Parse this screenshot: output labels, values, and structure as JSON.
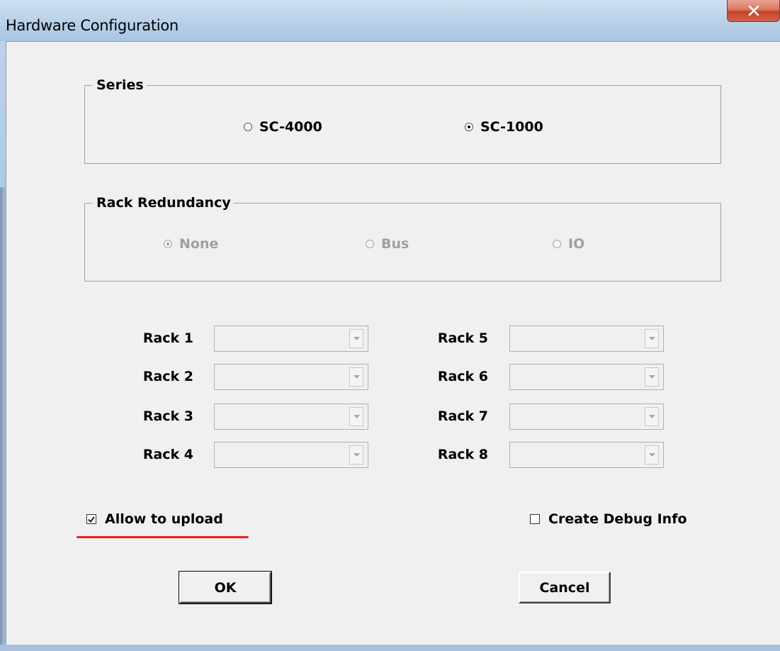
{
  "window": {
    "title": "Hardware Configuration",
    "close_glyph": "x"
  },
  "series": {
    "legend": "Series",
    "options": [
      {
        "label": "SC-4000",
        "checked": false
      },
      {
        "label": "SC-1000",
        "checked": true
      }
    ]
  },
  "rack_redundancy": {
    "legend": "Rack Redundancy",
    "enabled": false,
    "options": [
      {
        "label": "None",
        "checked": true
      },
      {
        "label": "Bus",
        "checked": false
      },
      {
        "label": "IO",
        "checked": false
      }
    ]
  },
  "racks": [
    {
      "label": "Rack 1",
      "value": ""
    },
    {
      "label": "Rack 2",
      "value": ""
    },
    {
      "label": "Rack 3",
      "value": ""
    },
    {
      "label": "Rack 4",
      "value": ""
    },
    {
      "label": "Rack 5",
      "value": ""
    },
    {
      "label": "Rack 6",
      "value": ""
    },
    {
      "label": "Rack 7",
      "value": ""
    },
    {
      "label": "Rack 8",
      "value": ""
    }
  ],
  "options": {
    "allow_upload": {
      "label": "Allow to upload",
      "checked": true
    },
    "create_debug_info": {
      "label": "Create Debug Info",
      "checked": false
    }
  },
  "buttons": {
    "ok": "OK",
    "cancel": "Cancel"
  },
  "colors": {
    "annotation_underline": "#ee1c24",
    "close_button": "#c4432a",
    "title_bar": "#bcd3ea"
  }
}
